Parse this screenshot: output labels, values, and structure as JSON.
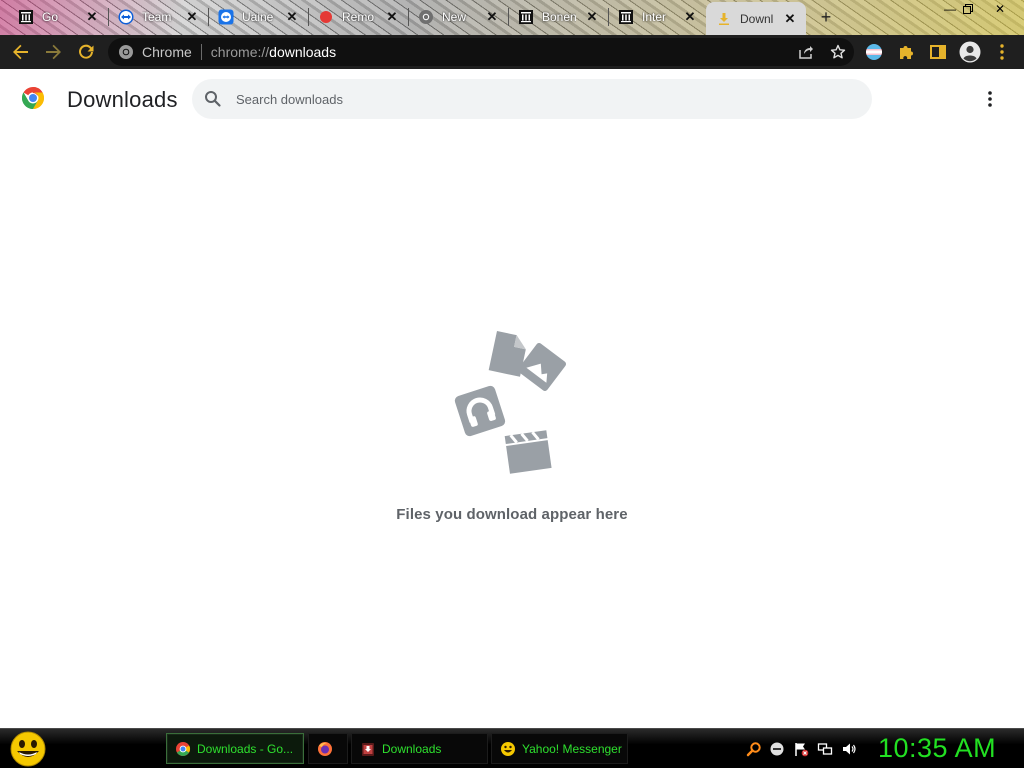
{
  "tabs": [
    {
      "title": "Go",
      "icon": "bank-icon"
    },
    {
      "title": "Team",
      "icon": "teamviewer-icon"
    },
    {
      "title": "Uaine",
      "icon": "teamviewer-icon"
    },
    {
      "title": "Remo",
      "icon": "red-dot-icon"
    },
    {
      "title": "New",
      "icon": "chrome-gray-icon"
    },
    {
      "title": "Bonen",
      "icon": "bank-icon"
    },
    {
      "title": "Inter",
      "icon": "bank-icon"
    },
    {
      "title": "Downl",
      "icon": "download-icon"
    }
  ],
  "omnibox": {
    "site_label": "Chrome",
    "url_scheme": "chrome://",
    "url_host": "downloads"
  },
  "page": {
    "title": "Downloads",
    "search_placeholder": "Search downloads",
    "empty_message": "Files you download appear here"
  },
  "taskbar": {
    "buttons": [
      {
        "label": "Downloads - Go...",
        "icon": "chrome-icon",
        "active": true
      },
      {
        "label": "",
        "icon": "firefox-icon",
        "active": false
      },
      {
        "label": "Downloads",
        "icon": "folder-icon",
        "active": false
      },
      {
        "label": "Yahoo! Messenger",
        "icon": "yahoo-smiley-icon",
        "active": false
      }
    ],
    "clock": "10:35 AM"
  },
  "colors": {
    "toolbar_bg": "#1f1f1f",
    "toolbar_icon": "#e6b32b",
    "taskbar_text": "#2ee02e",
    "illustration": "#9aa0a6"
  }
}
